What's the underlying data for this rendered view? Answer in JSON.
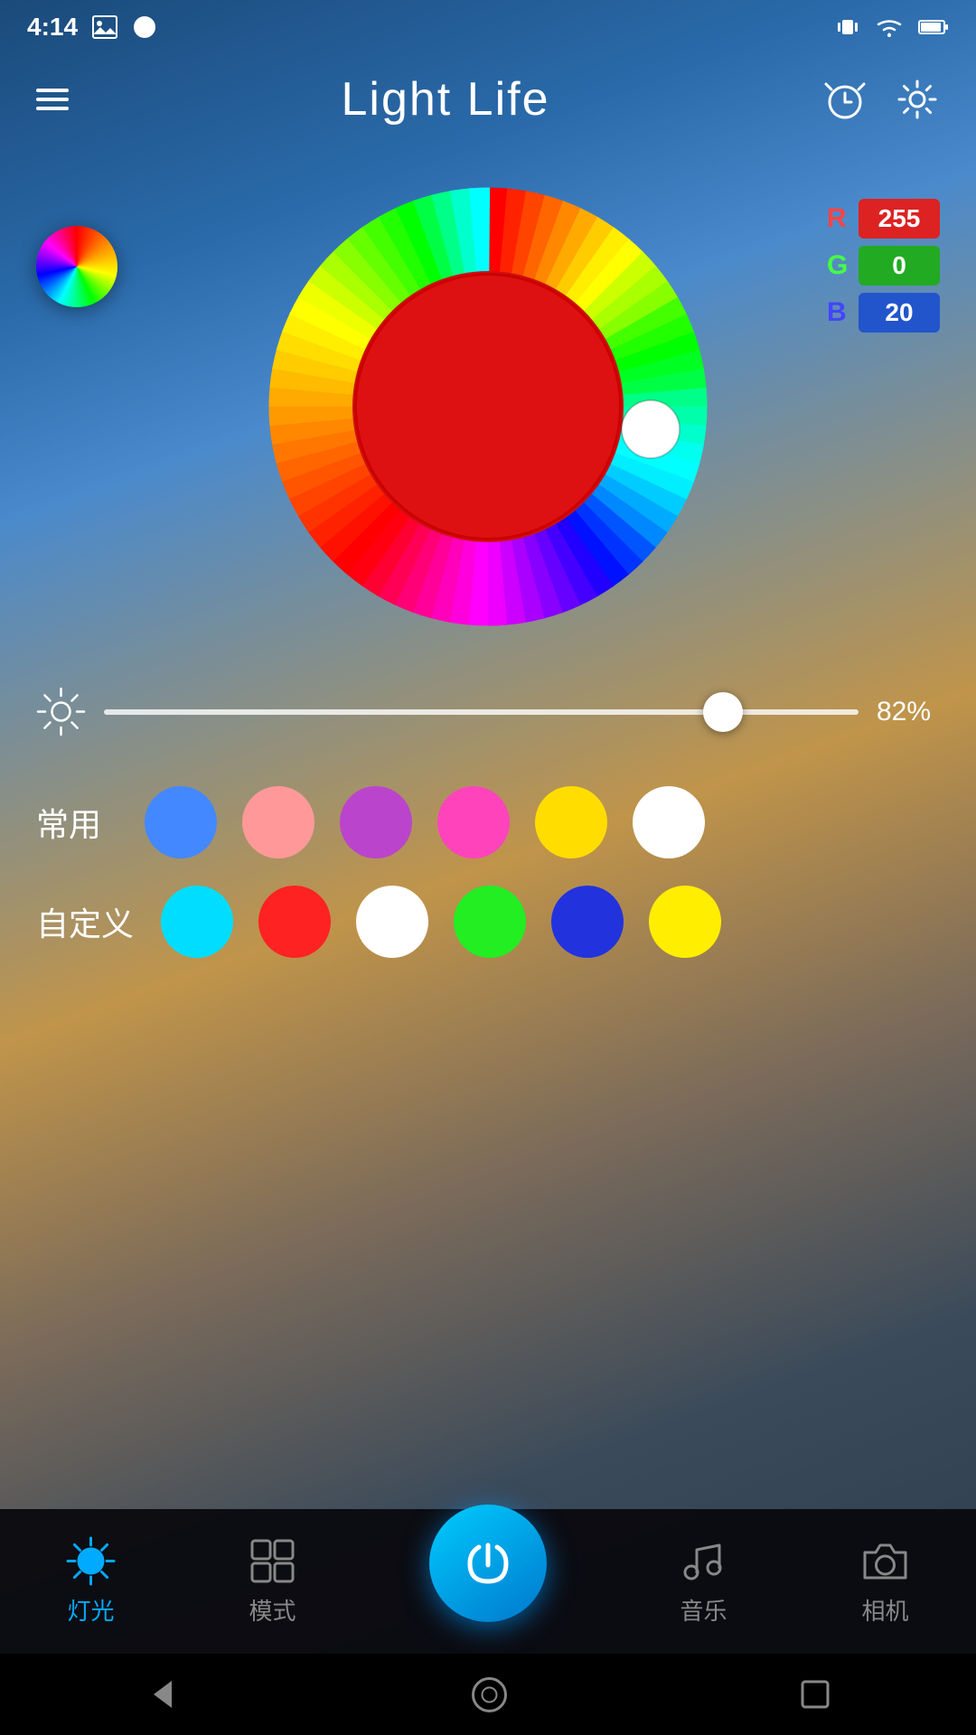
{
  "status": {
    "time": "4:14",
    "signal_icon": "vibrate",
    "wifi_icon": "wifi",
    "battery_icon": "battery"
  },
  "app_bar": {
    "title": "Light Life",
    "menu_icon": "hamburger-menu",
    "clock_icon": "alarm-clock",
    "settings_icon": "gear"
  },
  "rgb": {
    "r_label": "R",
    "g_label": "G",
    "b_label": "B",
    "r_value": "255",
    "g_value": "0",
    "b_value": "20"
  },
  "brightness": {
    "value": "82%"
  },
  "presets": {
    "common_label": "常用",
    "custom_label": "自定义",
    "common_colors": [
      "#4488ff",
      "#ff9999",
      "#bb44cc",
      "#ff44bb",
      "#ffdd00",
      "#ffffff"
    ],
    "custom_colors": [
      "#00ddff",
      "#ff2222",
      "#ffffff",
      "#22ee22",
      "#2233dd",
      "#ffee00"
    ]
  },
  "nav": {
    "light_label": "灯光",
    "mode_label": "模式",
    "power_icon": "power",
    "music_label": "音乐",
    "camera_label": "相机"
  },
  "android_nav": {
    "back_icon": "back-triangle",
    "home_icon": "home-circle",
    "recent_icon": "recent-square"
  }
}
